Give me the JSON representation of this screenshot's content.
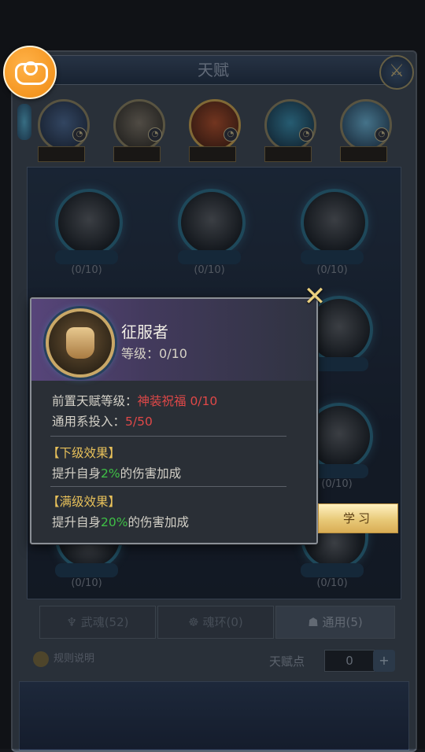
{
  "window": {
    "title": "天赋",
    "close_icon": "crossed-swords-close-icon"
  },
  "floating_button": {
    "icon": "gamepad-icon"
  },
  "categories": [
    {
      "label": "",
      "badge": ""
    },
    {
      "label": "",
      "badge": ""
    },
    {
      "label": "",
      "badge": ""
    },
    {
      "label": "",
      "badge": ""
    },
    {
      "label": "",
      "badge": ""
    }
  ],
  "tree_nodes": [
    {
      "name": "",
      "count": "(0/10)"
    },
    {
      "name": "",
      "count": "(0/10)"
    },
    {
      "name": "",
      "count": "(0/10)"
    },
    {
      "name": "",
      "count": ""
    },
    {
      "name": "",
      "count": "(0/10)"
    },
    {
      "name": "",
      "count": "(0/10)"
    },
    {
      "name": "",
      "count": "(0/10)"
    }
  ],
  "tabs": [
    {
      "label": "武魂(52)"
    },
    {
      "label": "魂环(0)"
    },
    {
      "label": "通用(5)"
    }
  ],
  "footer": {
    "rules_label": "规则说明",
    "points_label": "天赋点",
    "points_value": "0",
    "plus_label": "+"
  },
  "popup": {
    "name": "征服者",
    "level_label": "等级：",
    "level_value": "0/10",
    "prereq_label": "前置天赋等级：",
    "prereq_name": "神装祝福 0/10",
    "invest_label": "通用系投入：",
    "invest_value": "5/50",
    "next_header": "【下级效果】",
    "next_pre": "提升自身",
    "next_value": "2%",
    "next_post": "的伤害加成",
    "max_header": "【满级效果】",
    "max_pre": "提升自身",
    "max_value": "20%",
    "max_post": "的伤害加成",
    "close_label": "✕",
    "learn_label": "学习"
  },
  "colors": {
    "accent_red": "#e04848",
    "accent_green": "#3fc046",
    "accent_gold": "#e8c15a"
  }
}
